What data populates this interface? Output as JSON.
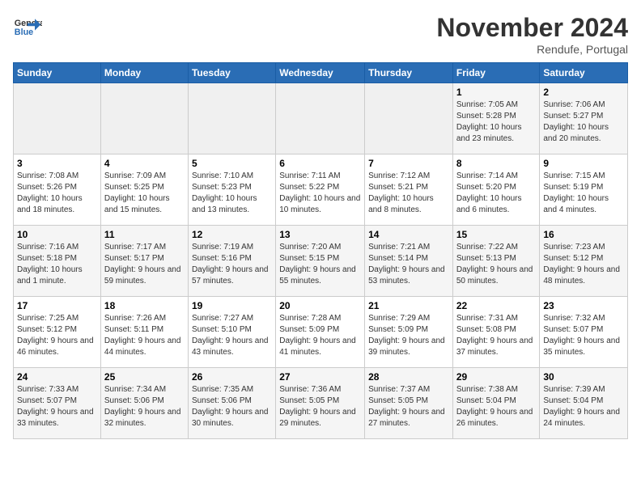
{
  "header": {
    "logo_line1": "General",
    "logo_line2": "Blue",
    "month": "November 2024",
    "location": "Rendufe, Portugal"
  },
  "weekdays": [
    "Sunday",
    "Monday",
    "Tuesday",
    "Wednesday",
    "Thursday",
    "Friday",
    "Saturday"
  ],
  "weeks": [
    [
      {
        "day": "",
        "info": ""
      },
      {
        "day": "",
        "info": ""
      },
      {
        "day": "",
        "info": ""
      },
      {
        "day": "",
        "info": ""
      },
      {
        "day": "",
        "info": ""
      },
      {
        "day": "1",
        "info": "Sunrise: 7:05 AM\nSunset: 5:28 PM\nDaylight: 10 hours and 23 minutes."
      },
      {
        "day": "2",
        "info": "Sunrise: 7:06 AM\nSunset: 5:27 PM\nDaylight: 10 hours and 20 minutes."
      }
    ],
    [
      {
        "day": "3",
        "info": "Sunrise: 7:08 AM\nSunset: 5:26 PM\nDaylight: 10 hours and 18 minutes."
      },
      {
        "day": "4",
        "info": "Sunrise: 7:09 AM\nSunset: 5:25 PM\nDaylight: 10 hours and 15 minutes."
      },
      {
        "day": "5",
        "info": "Sunrise: 7:10 AM\nSunset: 5:23 PM\nDaylight: 10 hours and 13 minutes."
      },
      {
        "day": "6",
        "info": "Sunrise: 7:11 AM\nSunset: 5:22 PM\nDaylight: 10 hours and 10 minutes."
      },
      {
        "day": "7",
        "info": "Sunrise: 7:12 AM\nSunset: 5:21 PM\nDaylight: 10 hours and 8 minutes."
      },
      {
        "day": "8",
        "info": "Sunrise: 7:14 AM\nSunset: 5:20 PM\nDaylight: 10 hours and 6 minutes."
      },
      {
        "day": "9",
        "info": "Sunrise: 7:15 AM\nSunset: 5:19 PM\nDaylight: 10 hours and 4 minutes."
      }
    ],
    [
      {
        "day": "10",
        "info": "Sunrise: 7:16 AM\nSunset: 5:18 PM\nDaylight: 10 hours and 1 minute."
      },
      {
        "day": "11",
        "info": "Sunrise: 7:17 AM\nSunset: 5:17 PM\nDaylight: 9 hours and 59 minutes."
      },
      {
        "day": "12",
        "info": "Sunrise: 7:19 AM\nSunset: 5:16 PM\nDaylight: 9 hours and 57 minutes."
      },
      {
        "day": "13",
        "info": "Sunrise: 7:20 AM\nSunset: 5:15 PM\nDaylight: 9 hours and 55 minutes."
      },
      {
        "day": "14",
        "info": "Sunrise: 7:21 AM\nSunset: 5:14 PM\nDaylight: 9 hours and 53 minutes."
      },
      {
        "day": "15",
        "info": "Sunrise: 7:22 AM\nSunset: 5:13 PM\nDaylight: 9 hours and 50 minutes."
      },
      {
        "day": "16",
        "info": "Sunrise: 7:23 AM\nSunset: 5:12 PM\nDaylight: 9 hours and 48 minutes."
      }
    ],
    [
      {
        "day": "17",
        "info": "Sunrise: 7:25 AM\nSunset: 5:12 PM\nDaylight: 9 hours and 46 minutes."
      },
      {
        "day": "18",
        "info": "Sunrise: 7:26 AM\nSunset: 5:11 PM\nDaylight: 9 hours and 44 minutes."
      },
      {
        "day": "19",
        "info": "Sunrise: 7:27 AM\nSunset: 5:10 PM\nDaylight: 9 hours and 43 minutes."
      },
      {
        "day": "20",
        "info": "Sunrise: 7:28 AM\nSunset: 5:09 PM\nDaylight: 9 hours and 41 minutes."
      },
      {
        "day": "21",
        "info": "Sunrise: 7:29 AM\nSunset: 5:09 PM\nDaylight: 9 hours and 39 minutes."
      },
      {
        "day": "22",
        "info": "Sunrise: 7:31 AM\nSunset: 5:08 PM\nDaylight: 9 hours and 37 minutes."
      },
      {
        "day": "23",
        "info": "Sunrise: 7:32 AM\nSunset: 5:07 PM\nDaylight: 9 hours and 35 minutes."
      }
    ],
    [
      {
        "day": "24",
        "info": "Sunrise: 7:33 AM\nSunset: 5:07 PM\nDaylight: 9 hours and 33 minutes."
      },
      {
        "day": "25",
        "info": "Sunrise: 7:34 AM\nSunset: 5:06 PM\nDaylight: 9 hours and 32 minutes."
      },
      {
        "day": "26",
        "info": "Sunrise: 7:35 AM\nSunset: 5:06 PM\nDaylight: 9 hours and 30 minutes."
      },
      {
        "day": "27",
        "info": "Sunrise: 7:36 AM\nSunset: 5:05 PM\nDaylight: 9 hours and 29 minutes."
      },
      {
        "day": "28",
        "info": "Sunrise: 7:37 AM\nSunset: 5:05 PM\nDaylight: 9 hours and 27 minutes."
      },
      {
        "day": "29",
        "info": "Sunrise: 7:38 AM\nSunset: 5:04 PM\nDaylight: 9 hours and 26 minutes."
      },
      {
        "day": "30",
        "info": "Sunrise: 7:39 AM\nSunset: 5:04 PM\nDaylight: 9 hours and 24 minutes."
      }
    ]
  ]
}
